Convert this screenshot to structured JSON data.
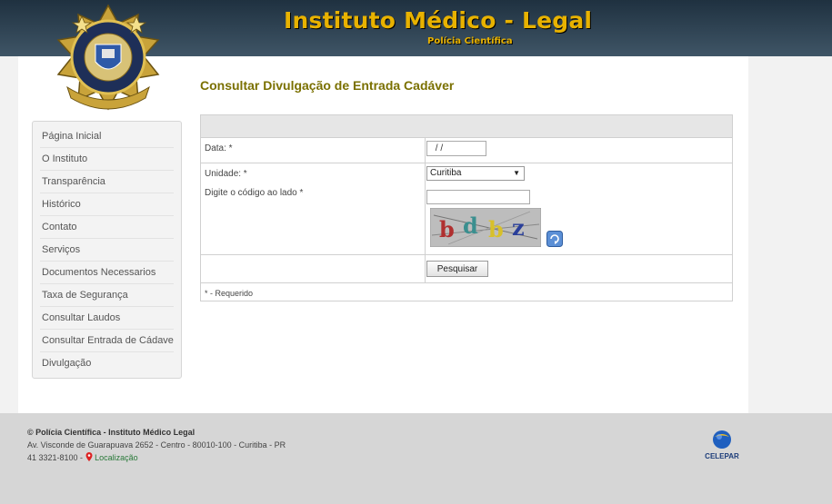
{
  "header": {
    "title": "Instituto Médico - Legal",
    "subtitle": "Polícia Científica"
  },
  "page_title": "Consultar Divulgação de Entrada Cadáver",
  "sidebar": {
    "items": [
      {
        "label": "Página Inicial"
      },
      {
        "label": "O Instituto"
      },
      {
        "label": "Transparência"
      },
      {
        "label": "Histórico"
      },
      {
        "label": "Contato"
      },
      {
        "label": "Serviços"
      },
      {
        "label": "Documentos Necessarios"
      },
      {
        "label": "Taxa de Segurança"
      },
      {
        "label": "Consultar Laudos"
      },
      {
        "label": "Consultar Entrada de Cádaver"
      },
      {
        "label": "Divulgação"
      }
    ]
  },
  "form": {
    "date_label": "Data: *",
    "date_value": " / /",
    "unit_label": "Unidade: *",
    "unit_value": "Curitiba",
    "captcha_label": "Digite o código ao lado *",
    "captcha_letters": [
      "b",
      "d",
      "b",
      "z"
    ],
    "search_button": "Pesquisar",
    "required_note": "* - Requerido"
  },
  "footer": {
    "org": "© Polícia Científica - Instituto Médico Legal",
    "address": "Av. Visconde de Guarapuava 2652 - Centro - 80010-100 - Curitiba - PR",
    "phone": "41 3321-8100 -",
    "map_link": "Localização",
    "logo_text": "CELEPAR"
  },
  "colors": {
    "header_bg": "#2c3e4e",
    "title_gold": "#e8b200",
    "page_title": "#7a7000"
  }
}
